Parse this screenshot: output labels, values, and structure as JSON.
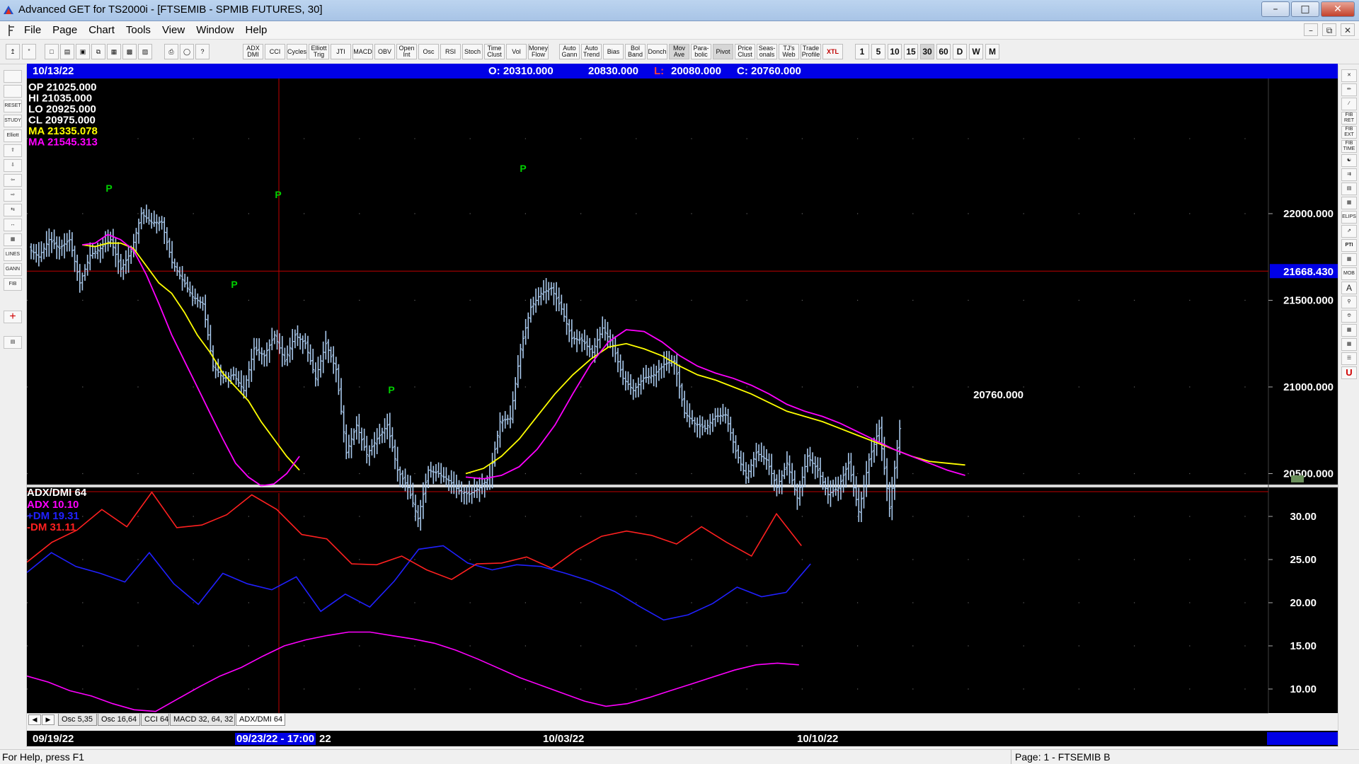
{
  "window": {
    "title": "Advanced GET for TS2000i - [FTSEMIB - SPMIB FUTURES, 30]"
  },
  "menu": [
    "File",
    "Page",
    "Chart",
    "Tools",
    "View",
    "Window",
    "Help"
  ],
  "toolbar": {
    "indicators": [
      "ADX DMI",
      "CCI",
      "Cycles",
      "Elliott Trig",
      "JTI",
      "MACD",
      "OBV",
      "Open Int",
      "Osc",
      "RSI",
      "Stoch",
      "Time Clust",
      "Vol",
      "Money Flow",
      "Auto Gann",
      "Auto Trend",
      "Bias",
      "Bol Band",
      "Donch",
      "Mov Ave",
      "Para-bolic",
      "Pivot",
      "Price Clust",
      "Seas-onals",
      "TJ's Web",
      "Trade Profile",
      "XTL"
    ],
    "periods": [
      "1",
      "5",
      "10",
      "15",
      "30",
      "60",
      "D",
      "W",
      "M"
    ],
    "active_period": "30"
  },
  "left_tools": [
    "",
    "",
    "RESET",
    "STUDY",
    "Elliott",
    "",
    "",
    "",
    "",
    "",
    "",
    "",
    "LINES",
    "GANN",
    "FIB",
    "",
    ""
  ],
  "right_tools": [
    "",
    "",
    "",
    "FIB RET",
    "FIB EXT",
    "FIB TIME",
    "",
    "",
    "",
    "",
    "ELIPS",
    "",
    "PTI",
    "",
    "MOB",
    "A",
    "",
    "",
    "",
    "",
    "",
    "U"
  ],
  "info_bar": {
    "date": "10/13/22",
    "open": "O: 20310.000",
    "high": "20830.000",
    "low_label": "L:",
    "low": "20080.000",
    "close": "C: 20760.000"
  },
  "price_panel": {
    "ohlc": [
      {
        "label": "OP",
        "value": "21025.000",
        "color": "#ffffff"
      },
      {
        "label": "HI",
        "value": "21035.000",
        "color": "#ffffff"
      },
      {
        "label": "LO",
        "value": "20925.000",
        "color": "#ffffff"
      },
      {
        "label": "CL",
        "value": "20975.000",
        "color": "#ffffff"
      },
      {
        "label": "MA",
        "value": "21335.078",
        "color": "#ffff00"
      },
      {
        "label": "MA",
        "value": "21545.313",
        "color": "#ff00ff"
      }
    ],
    "axis_ticks": [
      {
        "label": "22000.000",
        "value": 22000
      },
      {
        "label": "21500.000",
        "value": 21500
      },
      {
        "label": "21000.000",
        "value": 21000
      },
      {
        "label": "20500.000",
        "value": 20500
      }
    ],
    "cursor_price": {
      "label": "21668.430",
      "value": 21668.43
    },
    "last_price": "20760.000",
    "pivot_label": "P",
    "colors": {
      "bars": "#a8c8ec",
      "ma_fast": "#ffff00",
      "ma_slow": "#ff00ff",
      "pivot": "#00d000",
      "cursor": "#c00000"
    }
  },
  "adx_panel": {
    "title": "ADX/DMI 64",
    "legend": [
      {
        "label": "ADX",
        "value": "10.10",
        "color": "#ff00ff"
      },
      {
        "label": "+DM",
        "value": "19.31",
        "color": "#2020ff"
      },
      {
        "label": "-DM",
        "value": "31.11",
        "color": "#ff2020"
      }
    ],
    "axis_ticks": [
      {
        "label": "30.00",
        "value": 30
      },
      {
        "label": "25.00",
        "value": 25
      },
      {
        "label": "20.00",
        "value": 20
      },
      {
        "label": "15.00",
        "value": 15
      },
      {
        "label": "10.00",
        "value": 10
      }
    ]
  },
  "tabs": [
    "Osc 5,35",
    "Osc 16,64",
    "CCI 64",
    "MACD 32, 64, 32",
    "ADX/DMI 64"
  ],
  "active_tab": "ADX/DMI 64",
  "date_axis": {
    "dates": [
      "09/19/22",
      "09/23/22 - 17:00",
      "22",
      "10/03/22",
      "10/10/22"
    ]
  },
  "status": {
    "help": "For Help, press F1",
    "page": "Page: 1 - FTSEMIB B"
  },
  "chart_data": {
    "type": "line",
    "title": "FTSEMIB - SPMIB FUTURES, 30",
    "x": [
      0,
      5,
      10,
      15,
      20,
      25,
      30,
      35,
      40,
      45,
      50,
      55,
      60,
      65,
      70,
      75,
      80,
      85,
      90,
      95,
      100,
      105,
      110,
      115,
      120,
      125,
      130,
      135,
      140,
      145,
      150,
      155,
      160,
      165,
      170,
      175,
      180,
      185,
      190,
      195,
      200,
      205,
      210,
      215,
      220,
      225,
      230,
      235,
      240,
      245,
      250,
      255,
      260,
      265,
      270,
      275,
      280,
      285,
      290,
      295,
      300,
      305,
      310,
      315,
      320,
      325,
      330,
      335,
      340,
      345,
      350,
      355,
      360,
      365,
      370,
      375,
      380,
      385,
      390,
      395,
      400,
      405,
      410,
      415,
      420,
      425,
      430,
      435,
      440,
      445
    ],
    "x_ticks": [
      "09/19/22",
      "10/03/22",
      "10/10/22"
    ],
    "ylim": [
      20000,
      22350
    ],
    "series": [
      {
        "name": "close",
        "values": [
          21800,
          21750,
          21850,
          21800,
          21850,
          21600,
          21760,
          21800,
          21850,
          21680,
          21780,
          22000,
          21950,
          21950,
          21720,
          21620,
          21520,
          21480,
          21120,
          21050,
          21070,
          20980,
          21220,
          21180,
          21300,
          21150,
          21300,
          21250,
          21050,
          21250,
          21100,
          20620,
          20780,
          20610,
          20700,
          20780,
          20520,
          20420,
          20240,
          20520,
          20500,
          20460,
          20400,
          20380,
          20420,
          20480,
          20800,
          20820,
          21220,
          21460,
          21540,
          21570,
          21450,
          21280,
          21270,
          21200,
          21340,
          21240,
          21050,
          20980,
          21050,
          21070,
          21130,
          21150,
          20850,
          20790,
          20760,
          20830,
          20840,
          20630,
          20480,
          20620,
          20580,
          20420,
          20560,
          20360,
          20600,
          20520,
          20380,
          20420,
          20560,
          20280,
          20580,
          20760,
          20300,
          20760,
          null,
          null,
          null,
          null
        ]
      },
      {
        "name": "ma_fast",
        "values": [
          null,
          null,
          null,
          null,
          21820,
          21810,
          21830,
          21830,
          21800,
          21700,
          21600,
          21540,
          21430,
          21300,
          21200,
          21080,
          21000,
          20920,
          20800,
          20700,
          20600,
          20520,
          20500,
          20520,
          20560,
          20650,
          20760,
          20900,
          21040,
          21140,
          21200,
          21220,
          21180,
          21080,
          20980,
          20900,
          20820,
          20750,
          20670,
          20600,
          20570,
          20560,
          null,
          null,
          null,
          null,
          null,
          null,
          null,
          null,
          null,
          null,
          null,
          null,
          null,
          null,
          null,
          null,
          null,
          null,
          null,
          null,
          null,
          null,
          null,
          null,
          null,
          null,
          null,
          null,
          null,
          null,
          null,
          null,
          null,
          null,
          null,
          null,
          null,
          null,
          null,
          null,
          null,
          null,
          null,
          null,
          null,
          null,
          null,
          null
        ]
      },
      {
        "name": "ma_slow",
        "values": [
          null,
          null,
          null,
          null,
          21820,
          21830,
          21880,
          21850,
          21790,
          21650,
          21480,
          21300,
          21150,
          21000,
          20850,
          20700,
          20560,
          20480,
          20430,
          20440,
          20500,
          20600,
          20760,
          21000,
          21250,
          21350,
          21340,
          21250,
          21140,
          21070,
          20980,
          20900,
          20830,
          20770,
          20700,
          20650,
          20600,
          20560,
          20520,
          20500,
          20480,
          20470,
          null,
          null,
          null,
          null,
          null,
          null,
          null,
          null,
          null,
          null,
          null,
          null,
          null,
          null,
          null,
          null,
          null,
          null,
          null,
          null,
          null,
          null,
          null,
          null,
          null,
          null,
          null,
          null,
          null,
          null,
          null,
          null,
          null,
          null,
          null,
          null,
          null,
          null,
          null,
          null,
          null,
          null,
          null,
          null,
          null,
          null,
          null,
          null
        ]
      },
      {
        "name": "ADX",
        "values": [
          11.5,
          10.8,
          9.8,
          9.2,
          8.3,
          7.6,
          7.4,
          8.8,
          10.2,
          11.5,
          12.5,
          13.8,
          15.0,
          15.7,
          16.2,
          16.6,
          16.6,
          16.2,
          15.8,
          15.3,
          14.5,
          13.5,
          12.4,
          11.3,
          10.4,
          9.5,
          8.6,
          8.0,
          8.3,
          9.0,
          9.8,
          10.6,
          11.4,
          12.2,
          12.8,
          13.0,
          12.8,
          null,
          null,
          null
        ]
      },
      {
        "name": "+DM",
        "values": [
          23.5,
          25.8,
          24.2,
          23.4,
          22.4,
          25.8,
          22.2,
          19.8,
          23.4,
          22.2,
          21.5,
          23.0,
          19.0,
          21.0,
          19.5,
          22.5,
          26.2,
          26.6,
          24.6,
          23.8,
          24.4,
          24.2,
          23.4,
          22.5,
          21.3,
          19.6,
          18.0,
          18.6,
          19.9,
          21.8,
          20.7,
          21.2,
          24.5,
          null,
          null,
          null,
          null,
          null,
          null,
          null
        ]
      },
      {
        "name": "-DM",
        "values": [
          24.7,
          27.0,
          28.4,
          30.8,
          28.8,
          32.8,
          28.7,
          29.0,
          30.2,
          32.5,
          30.8,
          27.9,
          27.4,
          24.5,
          24.4,
          25.4,
          23.8,
          22.7,
          24.5,
          24.6,
          25.3,
          24.0,
          26.1,
          27.7,
          28.3,
          27.8,
          26.8,
          28.8,
          27.0,
          25.4,
          30.3,
          26.6,
          null,
          null,
          null,
          null,
          null,
          null,
          null,
          null
        ]
      }
    ]
  }
}
